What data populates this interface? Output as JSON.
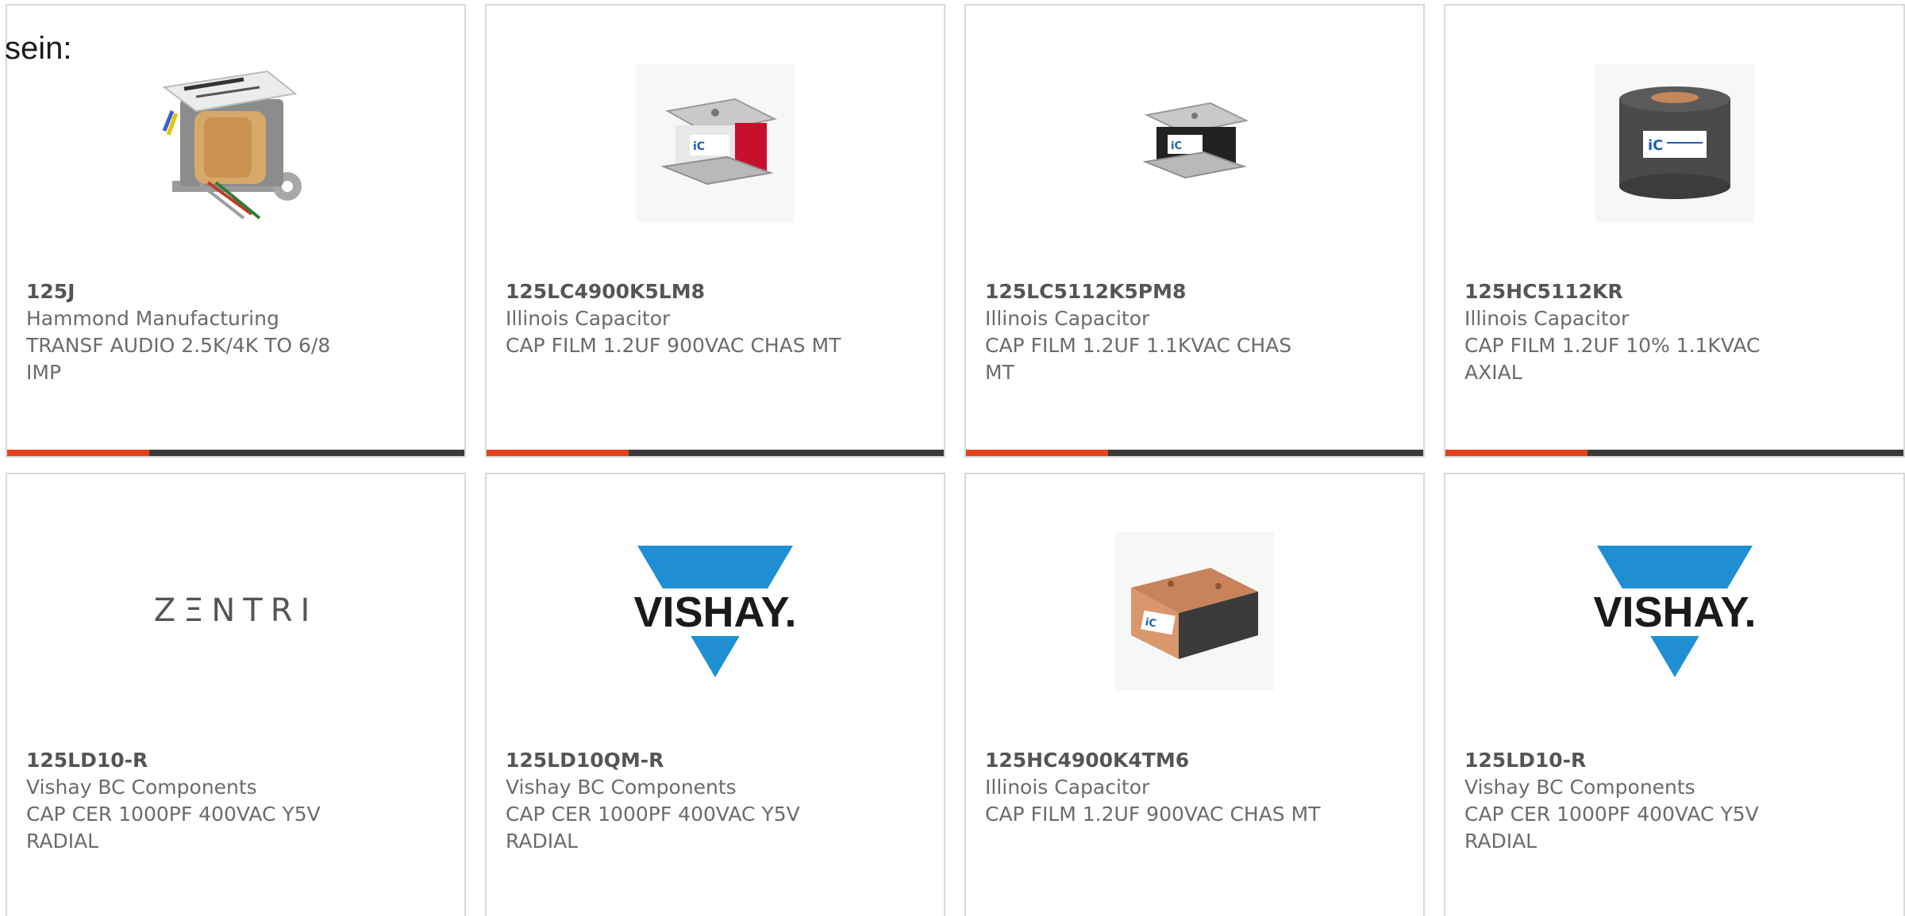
{
  "intro_text": "sein:",
  "colors": {
    "accent": "#e8401c",
    "bar_track": "#3a3a3a",
    "card_border": "#d9d9d9",
    "text": "#6b6b6b",
    "vishay_blue": "#1f8fd1"
  },
  "products": [
    {
      "part_number": "125J",
      "manufacturer": "Hammond Manufacturing",
      "description": "TRANSF AUDIO 2.5K/4K TO 6/8 IMP",
      "image": "transformer-photo",
      "progress_fraction": 0.31
    },
    {
      "part_number": "125LC4900K5LM8",
      "manufacturer": "Illinois Capacitor",
      "description": "CAP FILM 1.2UF 900VAC CHAS MT",
      "image": "chassis-capacitor-red-photo",
      "progress_fraction": 0.31
    },
    {
      "part_number": "125LC5112K5PM8",
      "manufacturer": "Illinois Capacitor",
      "description": "CAP FILM 1.2UF 1.1KVAC CHAS MT",
      "image": "chassis-capacitor-black-photo",
      "progress_fraction": 0.31
    },
    {
      "part_number": "125HC5112KR",
      "manufacturer": "Illinois Capacitor",
      "description": "CAP FILM 1.2UF 10% 1.1KVAC AXIAL",
      "image": "cylindrical-capacitor-photo",
      "progress_fraction": 0.31
    },
    {
      "part_number": "125LD10-R",
      "manufacturer": "Vishay BC Components",
      "description": "CAP CER 1000PF 400VAC Y5V RADIAL",
      "image": "zentri-logo",
      "logo_text": "ZΞNTRI"
    },
    {
      "part_number": "125LD10QM-R",
      "manufacturer": "Vishay BC Components",
      "description": "CAP CER 1000PF 400VAC Y5V RADIAL",
      "image": "vishay-logo",
      "logo_text": "VISHAY."
    },
    {
      "part_number": "125HC4900K4TM6",
      "manufacturer": "Illinois Capacitor",
      "description": "CAP FILM 1.2UF 900VAC CHAS MT",
      "image": "copper-block-capacitor-photo"
    },
    {
      "part_number": "125LD10-R",
      "manufacturer": "Vishay BC Components",
      "description": "CAP CER 1000PF 400VAC Y5V RADIAL",
      "image": "vishay-logo",
      "logo_text": "VISHAY."
    }
  ]
}
